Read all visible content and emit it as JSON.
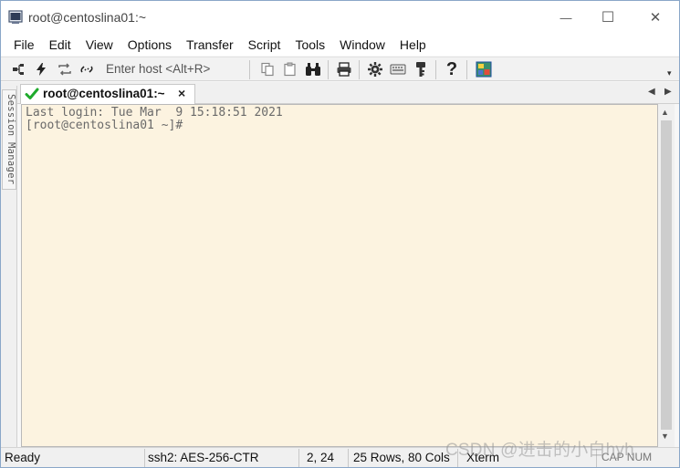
{
  "window": {
    "title": "root@centoslina01:~",
    "minimize_glyph": "—",
    "maximize_glyph": "☐",
    "close_glyph": "✕"
  },
  "menu": [
    "File",
    "Edit",
    "View",
    "Options",
    "Transfer",
    "Script",
    "Tools",
    "Window",
    "Help"
  ],
  "toolbar": {
    "host_placeholder": "Enter host <Alt+R>",
    "help_glyph": "?",
    "icons": [
      "connect-icon",
      "quick-connect-icon",
      "reconnect-icon",
      "disconnect-icon",
      "copy-icon",
      "paste-icon",
      "find-icon",
      "print-icon",
      "settings-icon",
      "keymap-icon",
      "key-icon",
      "help-icon",
      "sftp-icon"
    ]
  },
  "tabs": [
    {
      "label": "root@centoslina01:~",
      "close_glyph": "×"
    }
  ],
  "tab_nav": {
    "prev_glyph": "◀",
    "next_glyph": "▶"
  },
  "session_manager": {
    "label": "Session Manager"
  },
  "terminal": {
    "lines": [
      "Last login: Tue Mar  9 15:18:51 2021",
      "[root@centoslina01 ~]#"
    ],
    "background_color": "#fcf3e0",
    "text_color": "#6a6a6a"
  },
  "scrollbar": {
    "up_glyph": "▲",
    "down_glyph": "▼"
  },
  "status": {
    "ready": "Ready",
    "cipher": "ssh2: AES-256-CTR",
    "cursor": "2,  24",
    "size": "25 Rows, 80 Cols",
    "terminal_type": "Xterm",
    "caps": "CAP NUM"
  },
  "watermark": "CSDN @进击的小白hyh"
}
